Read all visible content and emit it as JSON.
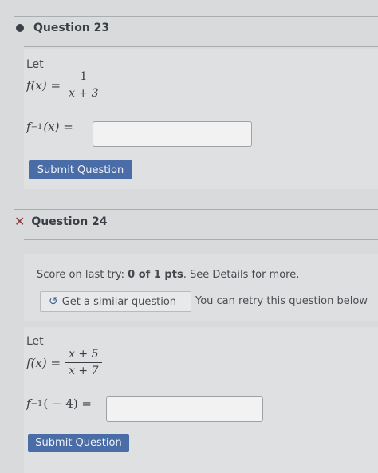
{
  "q23": {
    "title": "Question 23",
    "let_label": "Let",
    "f_lhs": "f(x) =",
    "numerator": "1",
    "denominator": "x + 3",
    "inverse_lhs": "f",
    "inverse_sup": "−1",
    "inverse_arg": "(x) =",
    "submit_label": "Submit Question"
  },
  "q24": {
    "title": "Question 24",
    "score_prefix": "Score on last try:",
    "score_value": "0 of 1 pts",
    "score_suffix": ". See Details for more.",
    "similar_icon": "↺",
    "similar_label": "Get a similar question",
    "retry_text": "You can retry this question below",
    "let_label": "Let",
    "f_lhs": "f(x) =",
    "numerator": "x + 5",
    "denominator": "x + 7",
    "inverse_lhs": "f",
    "inverse_sup": "−1",
    "inverse_arg": "( − 4) =",
    "submit_label": "Submit Question"
  },
  "colors": {
    "background": "#d9dadc",
    "submit_button": "#4a6da7",
    "wrong_mark": "#8e3b3b"
  }
}
